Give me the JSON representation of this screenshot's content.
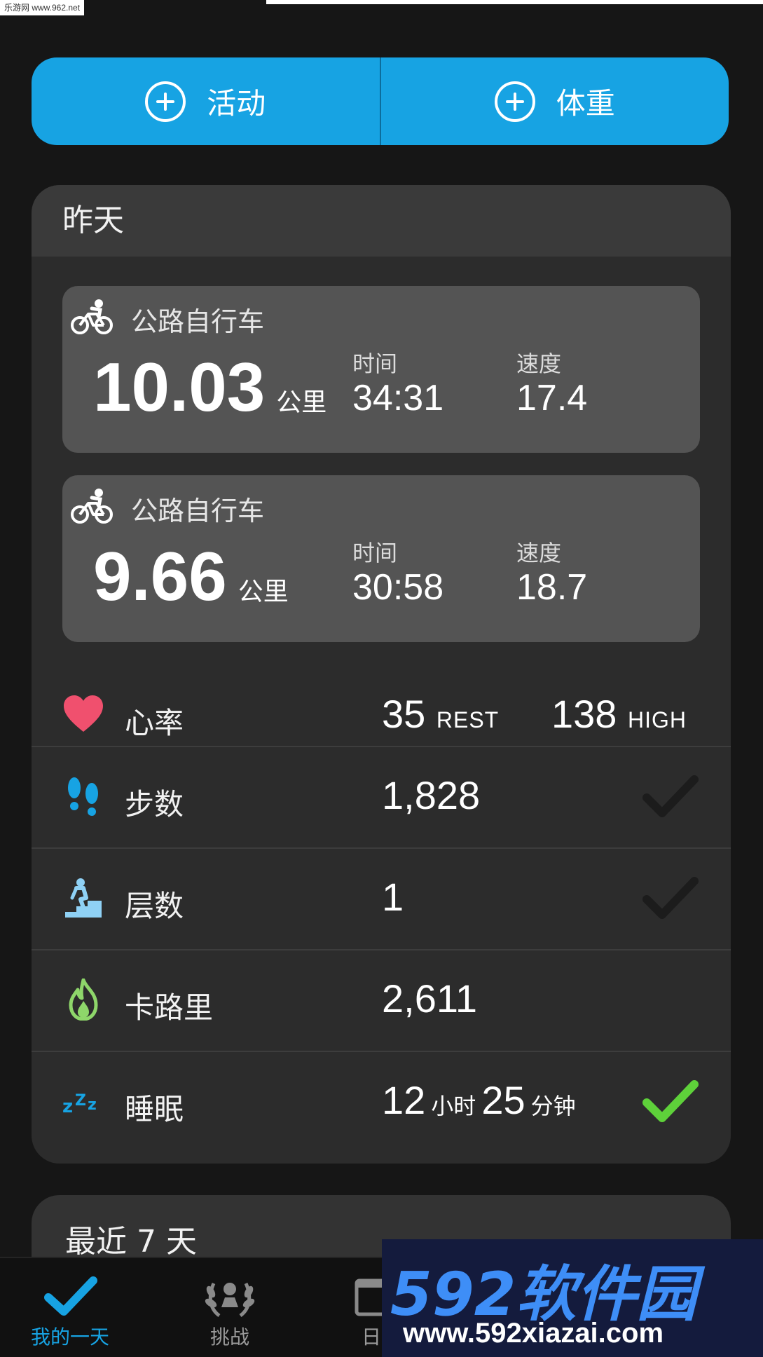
{
  "source_tag": "乐游网 www.962.net",
  "actions": {
    "activity_label": "活动",
    "weight_label": "体重"
  },
  "day_card": {
    "title": "昨天",
    "activities": [
      {
        "name": "公路自行车",
        "distance": "10.03",
        "unit": "公里",
        "time_label": "时间",
        "time": "34:31",
        "speed_label": "速度",
        "speed": "17.4"
      },
      {
        "name": "公路自行车",
        "distance": "9.66",
        "unit": "公里",
        "time_label": "时间",
        "time": "30:58",
        "speed_label": "速度",
        "speed": "18.7"
      }
    ],
    "heart_rate": {
      "label": "心率",
      "rest": "35",
      "rest_unit": "REST",
      "high": "138",
      "high_unit": "HIGH",
      "icon": "heart-icon",
      "color": "#f0506e"
    },
    "steps": {
      "label": "步数",
      "value": "1,828",
      "goal_met": true,
      "icon": "footprints-icon",
      "color": "#17a3e3"
    },
    "floors": {
      "label": "层数",
      "value": "1",
      "goal_met": true,
      "icon": "stairs-climber-icon",
      "color": "#8fd1f5"
    },
    "calories": {
      "label": "卡路里",
      "value": "2,611",
      "icon": "flame-icon",
      "color": "#8ed66a"
    },
    "sleep": {
      "label": "睡眠",
      "hours": "12",
      "hours_unit": "小时",
      "minutes": "25",
      "minutes_unit": "分钟",
      "goal_met": true,
      "icon": "zzz-icon",
      "color": "#17a3e3"
    }
  },
  "recent_card": {
    "title": "最近 7 天"
  },
  "nav": {
    "items": [
      {
        "label": "我的一天",
        "icon": "checkmark-icon",
        "active": true
      },
      {
        "label": "挑战",
        "icon": "laurel-wreath-icon",
        "active": false
      },
      {
        "label": "日",
        "icon": "calendar-icon",
        "active": false
      }
    ]
  },
  "watermark": {
    "brand": "592软件园",
    "url": "www.592xiazai.com"
  },
  "colors": {
    "accent": "#17a3e3",
    "check_dim": "#1c1c1c",
    "check_green": "#5ed13a"
  }
}
